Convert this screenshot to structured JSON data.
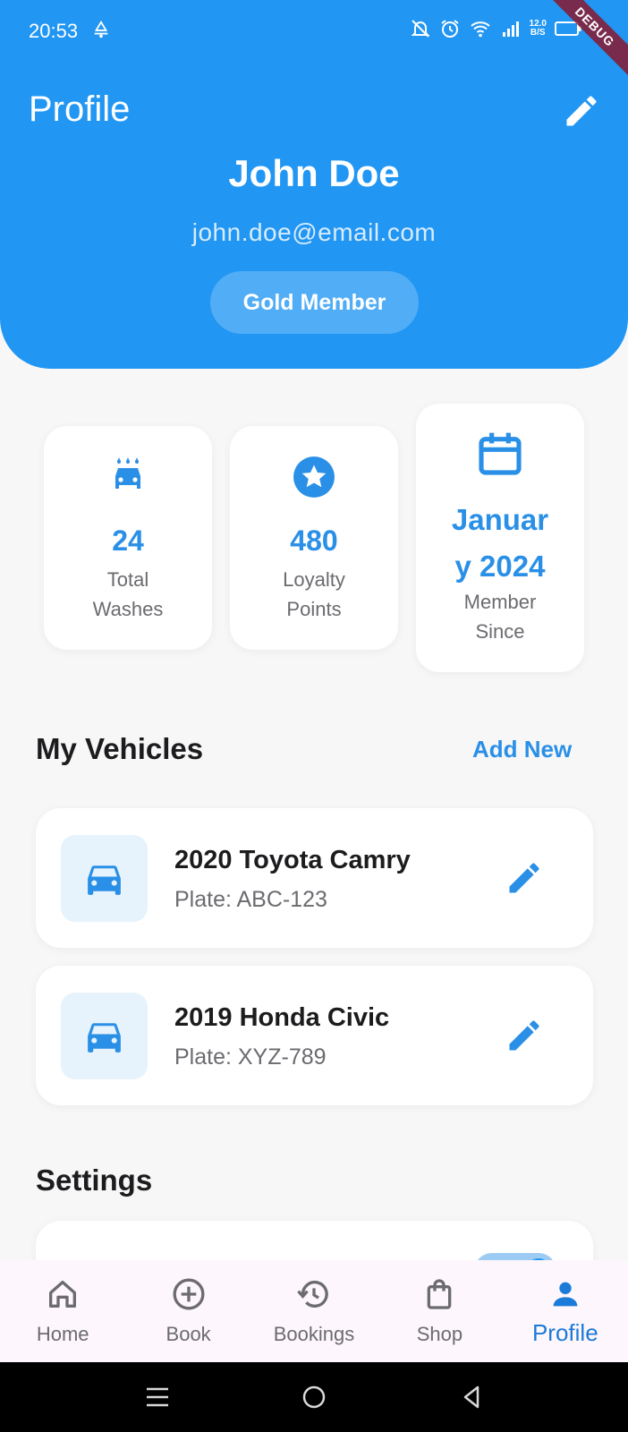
{
  "status_bar": {
    "time": "20:53",
    "net_speed_value": "12.0",
    "net_speed_unit": "B/S",
    "debug_banner": "DEBUG"
  },
  "header": {
    "title": "Profile",
    "user_name": "John Doe",
    "user_email": "john.doe@email.com",
    "membership_badge": "Gold Member",
    "edit_icon": "pencil-icon"
  },
  "stats": [
    {
      "value": "24",
      "label_line1": "Total",
      "label_line2": "Washes",
      "icon": "car-wash-icon"
    },
    {
      "value": "480",
      "label_line1": "Loyalty",
      "label_line2": "Points",
      "icon": "star-icon"
    },
    {
      "value_line1": "Januar",
      "value_line2": "y 2024",
      "label_line1": "Member",
      "label_line2": "Since",
      "icon": "calendar-icon"
    }
  ],
  "vehicles_section": {
    "title": "My Vehicles",
    "add_new_label": "Add New",
    "items": [
      {
        "name": "2020 Toyota Camry",
        "plate": "Plate: ABC-123",
        "icon": "car-icon"
      },
      {
        "name": "2019 Honda Civic",
        "plate": "Plate: XYZ-789",
        "icon": "car-icon"
      }
    ]
  },
  "settings_section": {
    "title": "Settings"
  },
  "bottom_nav": {
    "items": [
      {
        "label": "Home",
        "icon": "home-icon",
        "active": false
      },
      {
        "label": "Book",
        "icon": "add-circle-icon",
        "active": false
      },
      {
        "label": "Bookings",
        "icon": "history-icon",
        "active": false
      },
      {
        "label": "Shop",
        "icon": "shopping-bag-icon",
        "active": false
      },
      {
        "label": "Profile",
        "icon": "person-icon",
        "active": true
      }
    ]
  },
  "colors": {
    "primary": "#2196f3",
    "accent_text": "#2a8fe6",
    "active_nav": "#1c7ad8",
    "background": "#f7f7f8"
  }
}
